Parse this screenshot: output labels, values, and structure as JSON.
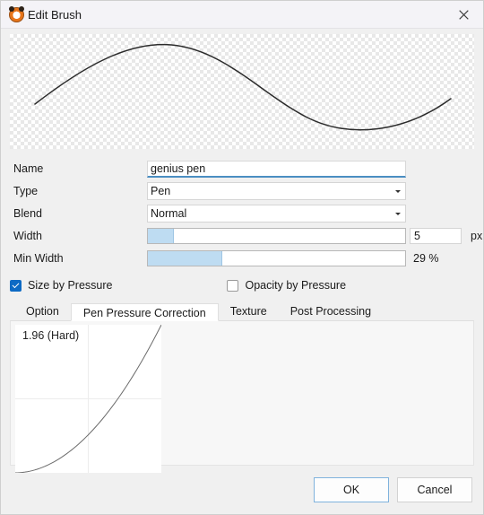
{
  "window": {
    "title": "Edit Brush",
    "icon": "app-brush-icon",
    "close_icon": "close-icon"
  },
  "preview": {
    "name": "brush-stroke-preview",
    "stroke_color": "#2b2b2b",
    "background": "checkerboard-transparency"
  },
  "form": {
    "name": {
      "label": "Name",
      "value": "genius pen",
      "placeholder": "",
      "focused": true
    },
    "type": {
      "label": "Type",
      "value": "Pen",
      "arrow_icon": "chevron-down-icon"
    },
    "blend": {
      "label": "Blend",
      "value": "Normal",
      "arrow_icon": "chevron-down-icon"
    },
    "width": {
      "label": "Width",
      "fill_percent": 10,
      "value": "5",
      "unit": "px"
    },
    "min_width": {
      "label": "Min Width",
      "fill_percent": 29,
      "value": "29 %"
    }
  },
  "checkboxes": [
    {
      "label": "Size by Pressure",
      "checked": true
    },
    {
      "label": "Opacity by Pressure",
      "checked": false
    }
  ],
  "tabs": {
    "items": [
      {
        "label": "Option",
        "active": false
      },
      {
        "label": "Pen Pressure Correction",
        "active": true
      },
      {
        "label": "Texture",
        "active": false
      },
      {
        "label": "Post Processing",
        "active": false
      }
    ],
    "active_index": 1
  },
  "curve": {
    "name": "pen-pressure-curve",
    "readout": "1.96 (Hard)",
    "gamma": 1.96,
    "hardness": "Hard",
    "grid_divisions": 2,
    "line_color": "#6b6b6b"
  },
  "footer": {
    "ok_label": "OK",
    "cancel_label": "Cancel"
  },
  "colors": {
    "accent": "#0d6ac4",
    "slider_fill": "#bedcf2",
    "focus_border": "#4a8ec2",
    "dialog_bg": "#f0f0f0"
  }
}
